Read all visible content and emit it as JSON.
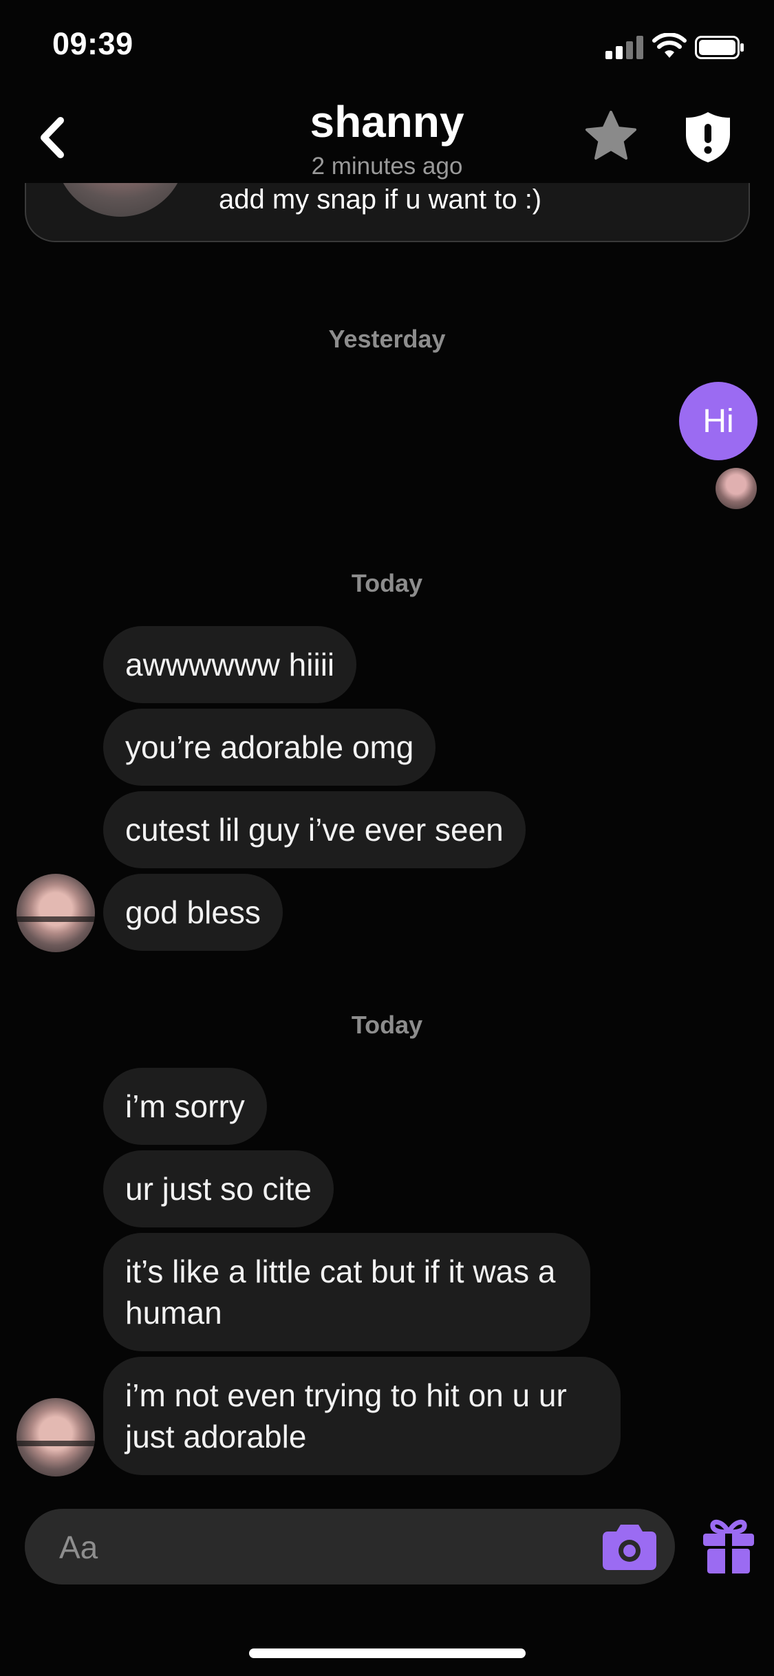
{
  "status_bar": {
    "time": "09:39"
  },
  "header": {
    "title": "shanny",
    "subtitle": "2 minutes ago",
    "icons": [
      "back-chevron-icon",
      "star-icon",
      "shield-alert-icon"
    ]
  },
  "bio": {
    "text": "add my snap if u want to :)"
  },
  "messages": {
    "day_yesterday": "Yesterday",
    "outgoing_1": "Hi",
    "day_today_1": "Today",
    "group1": [
      "awwwwww hiiii",
      "you’re adorable omg",
      "cutest lil guy i’ve ever seen",
      "god bless"
    ],
    "day_today_2": "Today",
    "group2": [
      "i’m sorry",
      "ur just so cite",
      "it’s like a little cat but if it was a human",
      "i’m not even trying to hit on u ur just adorable"
    ]
  },
  "composer": {
    "placeholder": "Aa",
    "icons": [
      "camera-icon",
      "gift-icon"
    ]
  },
  "colors": {
    "background": "#050505",
    "bubble_incoming": "#1d1d1d",
    "bubble_outgoing": "#9b6bf2",
    "accent": "#9b6bf2"
  }
}
